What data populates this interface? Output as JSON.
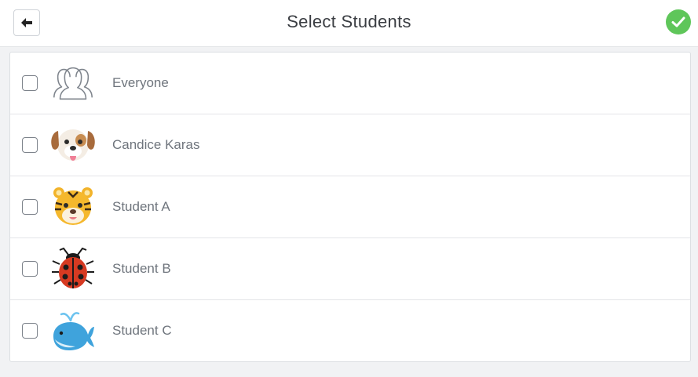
{
  "header": {
    "title": "Select Students",
    "back_icon": "arrow-left-icon",
    "done_icon": "check-circle-icon",
    "done_color": "#5fc65a"
  },
  "students": [
    {
      "label": "Everyone",
      "avatar": "group-outline-icon",
      "checked": false
    },
    {
      "label": "Candice Karas",
      "avatar": "dog-face-icon",
      "checked": false
    },
    {
      "label": "Student A",
      "avatar": "tiger-face-icon",
      "checked": false
    },
    {
      "label": "Student B",
      "avatar": "ladybug-icon",
      "checked": false
    },
    {
      "label": "Student C",
      "avatar": "whale-icon",
      "checked": false
    }
  ]
}
